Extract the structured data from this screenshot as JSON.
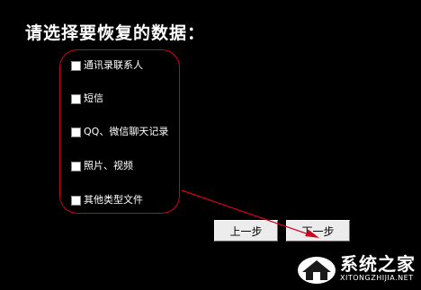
{
  "title": "请选择要恢复的数据：",
  "options": [
    {
      "label": "通讯录联系人",
      "checked": false
    },
    {
      "label": "短信",
      "checked": false
    },
    {
      "label": "QQ、微信聊天记录",
      "checked": false
    },
    {
      "label": "照片、视频",
      "checked": false
    },
    {
      "label": "其他类型文件",
      "checked": false
    }
  ],
  "buttons": {
    "prev": "上一步",
    "next": "下一步"
  },
  "watermark": {
    "cn": "系统之家",
    "en": "XITONGZHIJIA.NET"
  },
  "colors": {
    "background": "#000000",
    "annotation": "#d1001f",
    "text": "#ffffff"
  }
}
